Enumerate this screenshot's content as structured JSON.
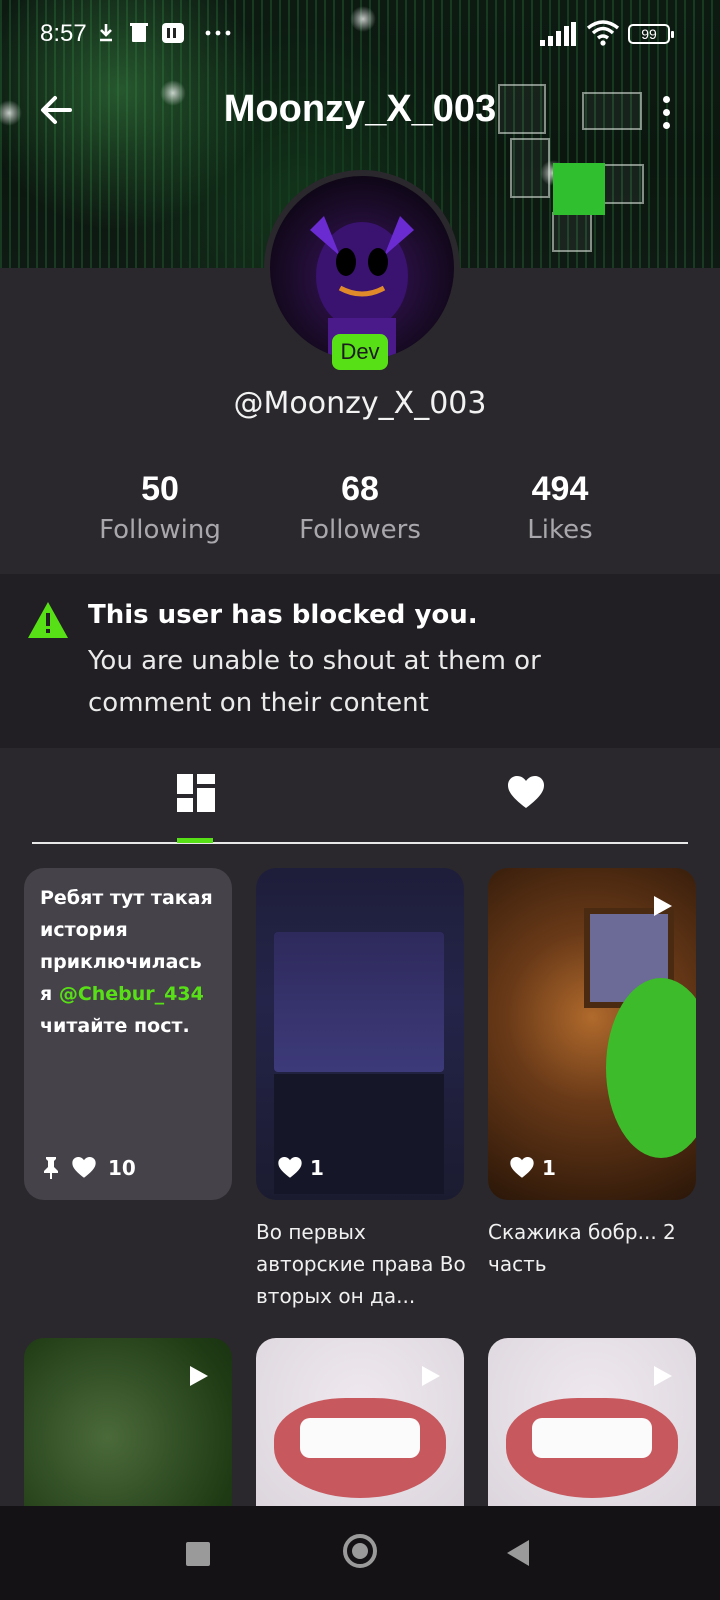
{
  "status_bar": {
    "time": "8:57",
    "battery": "99"
  },
  "header": {
    "title": "Moonzy_X_003"
  },
  "profile": {
    "badge": "Dev",
    "handle": "@Moonzy_X_003"
  },
  "stats": [
    {
      "value": "50",
      "label": "Following"
    },
    {
      "value": "68",
      "label": "Followers"
    },
    {
      "value": "494",
      "label": "Likes"
    }
  ],
  "blocked_notice": {
    "title": "This user has blocked you.",
    "body": "You are unable to shout at them or comment on their content"
  },
  "colors": {
    "accent": "#58e016",
    "background": "#2a282c",
    "notice_bg": "#211f23"
  },
  "posts": {
    "text_post": {
      "text_before": "Ребят тут такая история приключилась я ",
      "mention": "@Chebur_434",
      "text_after": " читайте пост.",
      "likes": "10"
    },
    "post2": {
      "likes": "1",
      "caption": "Во первых авторские права Во вторых он да..."
    },
    "post3": {
      "likes": "1",
      "caption": "Скажика бобр... 2 часть"
    }
  }
}
